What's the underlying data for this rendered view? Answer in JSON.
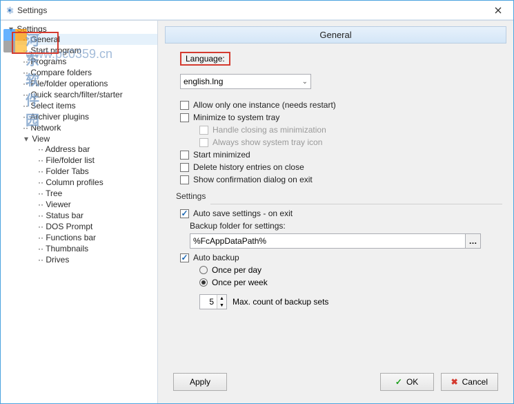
{
  "window": {
    "title": "Settings"
  },
  "watermark": {
    "text1": "河东软件园",
    "text2": "www.pc0359.cn"
  },
  "tree": {
    "root": "Settings",
    "items": [
      "General",
      "Start program",
      "Programs",
      "Compare folders",
      "File/folder operations",
      "Quick search/filter/starter",
      "Select items",
      "Archiver plugins",
      "Network"
    ],
    "view": "View",
    "view_items": [
      "Address bar",
      "File/folder list",
      "Folder Tabs",
      "Column profiles",
      "Tree",
      "Viewer",
      "Status bar",
      "DOS Prompt",
      "Functions bar",
      "Thumbnails",
      "Drives"
    ]
  },
  "panel": {
    "title": "General",
    "language_label": "Language:",
    "language_value": "english.lng",
    "cb_one_instance": "Allow only one instance (needs restart)",
    "cb_min_tray": "Minimize to system tray",
    "cb_handle_close": "Handle closing as minimization",
    "cb_always_tray": "Always show system tray icon",
    "cb_start_min": "Start minimized",
    "cb_delete_history": "Delete history entries on close",
    "cb_confirm_exit": "Show confirmation dialog on exit",
    "settings_group": "Settings",
    "cb_autosave": "Auto save settings - on exit",
    "backup_folder_label": "Backup folder for settings:",
    "backup_folder_value": "%FcAppDataPath%",
    "cb_autobackup": "Auto backup",
    "rb_once_day": "Once per day",
    "rb_once_week": "Once per week",
    "max_count_value": "5",
    "max_count_label": "Max. count of backup sets"
  },
  "footer": {
    "apply": "Apply",
    "ok": "OK",
    "cancel": "Cancel"
  }
}
